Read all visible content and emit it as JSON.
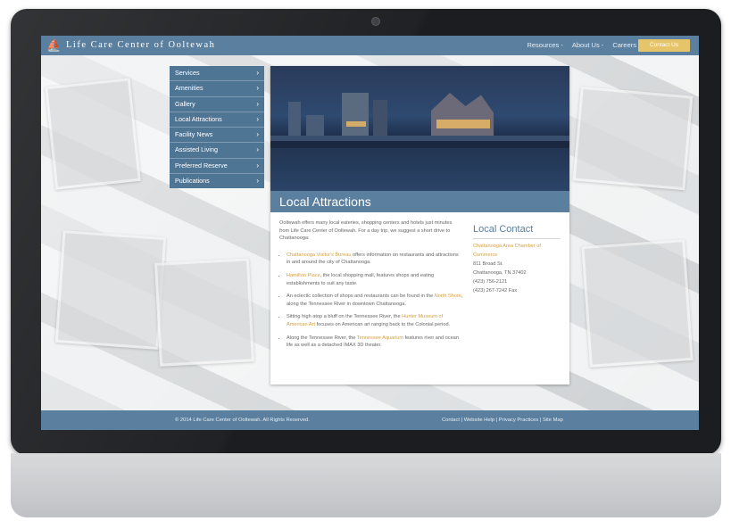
{
  "header": {
    "brand": "Life Care Center of Ooltewah",
    "nav": [
      "Resources -",
      "About Us -",
      "Careers"
    ],
    "contact_button": "Contact Us"
  },
  "sidenav": {
    "items": [
      "Services",
      "Amenities",
      "Gallery",
      "Local Attractions",
      "Facility News",
      "Assisted Living",
      "Preferred Reserve",
      "Publications"
    ]
  },
  "main": {
    "title": "Local Attractions",
    "intro": "Ooltewah offers many local eateries, shopping centers and hotels just minutes from Life Care Center of Ooltewah. For a day trip, we suggest a short drive to Chattanooga:",
    "bullets": [
      {
        "pre": "",
        "link": "Chattanooga Visitor's Bureau",
        "post": " offers information on restaurants and attractions in and around the city of Chattanooga."
      },
      {
        "pre": "",
        "link": "Hamilton Place",
        "post": ", the local shopping mall, features shops and eating establishments to suit any taste."
      },
      {
        "pre": "An eclectic collection of shops and restaurants can be found in the ",
        "link": "North Shore",
        "post": ", along the Tennessee River in downtown Chattanooga."
      },
      {
        "pre": "Sitting high atop a bluff on the Tennessee River, the ",
        "link": "Hunter Museum of American Art",
        "post": " focuses on American art ranging back to the Colonial period."
      },
      {
        "pre": "Along the Tennessee River, the ",
        "link": "Tennessee Aquarium",
        "post": " features river and ocean life as well as a detached IMAX 3D theater."
      }
    ]
  },
  "local_contact": {
    "heading": "Local Contact",
    "org": "Chattanooga Area Chamber of Commerce",
    "address1": "811 Broad St.",
    "address2": "Chattanooga, TN 37402",
    "phone": "(423) 756-2121",
    "fax": "(423) 267-7242 Fax"
  },
  "footer": {
    "copyright": "© 2014 Life Care Center of Ooltewah. All Rights Reserved.",
    "links": "Contact | Website Help | Privacy Practices | Site Map"
  },
  "colors": {
    "primary": "#5b7f9e",
    "sidenav": "#4f7595",
    "accent": "#e5c46a",
    "link": "#d79e3d"
  },
  "icons": {
    "logo": "sailboat-logo-icon",
    "nav_chevron": "chevron-right-icon"
  }
}
